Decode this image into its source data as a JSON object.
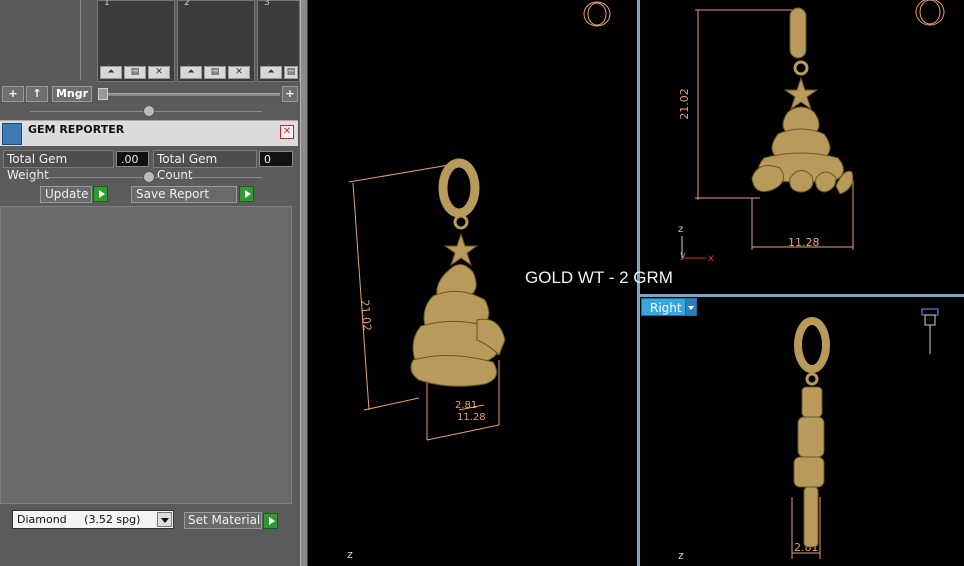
{
  "layers": {
    "columns": [
      {
        "number": "1"
      },
      {
        "number": "2"
      },
      {
        "number": "3"
      }
    ]
  },
  "toolbar": {
    "add_label": "+",
    "up_label": "↑",
    "manager_label": "Mngr",
    "plus_label": "+"
  },
  "gem_reporter": {
    "title": "GEM REPORTER",
    "close_label": "✕",
    "total_weight_label": "Total Gem Weight",
    "total_weight_value": ".00",
    "total_count_label": "Total Gem Count",
    "total_count_value": "0",
    "update_label": "Update",
    "save_report_label": "Save Report",
    "material_value": "Diamond     (3.52 spg)",
    "set_material_label": "Set Material"
  },
  "overlay": {
    "gold_weight": "GOLD WT - 2 GRM"
  },
  "viewports": {
    "perspective": {
      "dim_height": "21.02",
      "dim_depth": "2.81",
      "dim_width": "11.28",
      "axis_z": "z"
    },
    "front": {
      "dim_height": "21.02",
      "dim_width": "11.28",
      "axis_z": "z",
      "axis_y": "y",
      "axis_x": "x"
    },
    "right": {
      "view_name": "Right",
      "dim_depth": "2.81",
      "axis_z": "z"
    }
  },
  "colors": {
    "gold": "#b89a5a",
    "dim_line": "#e8a070",
    "viewport_border": "#7aa6c7",
    "view_tag": "#3aa6e0"
  }
}
